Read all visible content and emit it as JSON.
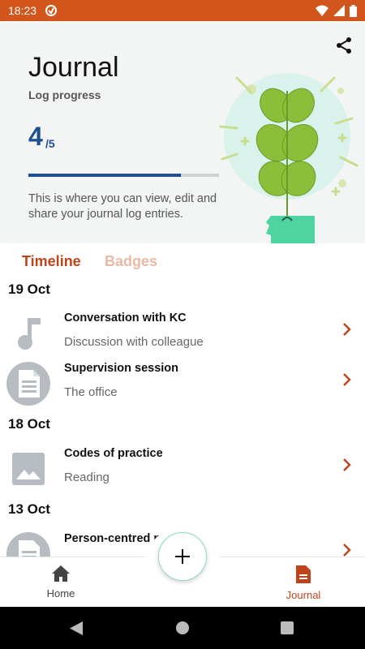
{
  "status_bar": {
    "time": "18:23"
  },
  "hero": {
    "title": "Journal",
    "subtitle": "Log progress",
    "progress_current": "4",
    "progress_total": "/5",
    "progress_fraction": 0.8,
    "description": "This is where you can view, edit and share your journal log entries."
  },
  "tabs": {
    "timeline": "Timeline",
    "badges": "Badges"
  },
  "groups": [
    {
      "date": "19 Oct"
    },
    {
      "date": "18 Oct"
    },
    {
      "date": "13 Oct"
    }
  ],
  "entries": [
    {
      "title": "Conversation with KC",
      "subtitle": "Discussion with colleague",
      "icon": "music-note-icon"
    },
    {
      "title": "Supervision session",
      "subtitle": "The office",
      "icon": "document-icon"
    },
    {
      "title": "Codes of practice",
      "subtitle": "Reading",
      "icon": "image-icon"
    },
    {
      "title": "Person-centred p",
      "subtitle": "",
      "icon": "document-icon"
    }
  ],
  "bottom_nav": {
    "home": "Home",
    "journal": "Journal"
  },
  "colors": {
    "accent": "#c0441b",
    "status_bar": "#d2551b",
    "progress": "#1d4f91",
    "illustration_green": "#8bbf3a"
  }
}
